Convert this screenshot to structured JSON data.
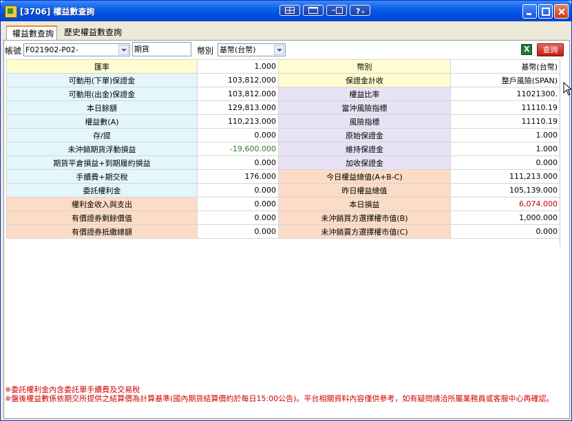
{
  "window": {
    "title": "[3706] 權益數查詢"
  },
  "tabs": [
    {
      "label": "權益數查詢"
    },
    {
      "label": "歷史權益數查詢"
    }
  ],
  "filters": {
    "account_label": "帳號",
    "account_value": "F021902-P02-",
    "type_value": "期貨",
    "currency_label": "幣別",
    "currency_value": "基幣(台幣)",
    "query_label": "查詢"
  },
  "table": {
    "rows": [
      {
        "l": "匯率",
        "lv": "1.000",
        "r": "幣別",
        "rv": "基幣(台幣)",
        "lc": "y",
        "rc": "y",
        "lvc": "",
        "rvc": ""
      },
      {
        "l": "可動用(下單)保證金",
        "lv": "103,812.000",
        "r": "保證金計收",
        "rv": "整戶風險(SPAN)",
        "lc": "b",
        "rc": "y",
        "lvc": "",
        "rvc": ""
      },
      {
        "l": "可動用(出金)保證金",
        "lv": "103,812.000",
        "r": "權益比率",
        "rv": "11021300.",
        "lc": "b",
        "rc": "p",
        "lvc": "",
        "rvc": ""
      },
      {
        "l": "本日餘額",
        "lv": "129,813.000",
        "r": "當沖風險指標",
        "rv": "11110.19",
        "lc": "b",
        "rc": "p",
        "lvc": "",
        "rvc": ""
      },
      {
        "l": "權益數(A)",
        "lv": "110,213.000",
        "r": "風險指標",
        "rv": "11110.19",
        "lc": "b",
        "rc": "p",
        "lvc": "",
        "rvc": ""
      },
      {
        "l": "存/提",
        "lv": "0.000",
        "r": "原始保證金",
        "rv": "1.000",
        "lc": "b",
        "rc": "p",
        "lvc": "",
        "rvc": ""
      },
      {
        "l": "未沖銷期貨浮動損益",
        "lv": "-19,600.000",
        "r": "維持保證金",
        "rv": "1.000",
        "lc": "b",
        "rc": "p",
        "lvc": "green",
        "rvc": ""
      },
      {
        "l": "期貨平倉損益+到期履約損益",
        "lv": "0.000",
        "r": "加收保證金",
        "rv": "0.000",
        "lc": "b",
        "rc": "p",
        "lvc": "",
        "rvc": ""
      },
      {
        "l": "手續費+期交稅",
        "lv": "176.000",
        "r": "今日權益總值(A+B-C)",
        "rv": "111,213.000",
        "lc": "b",
        "rc": "o",
        "lvc": "",
        "rvc": ""
      },
      {
        "l": "委託權利金",
        "lv": "0.000",
        "r": "昨日權益總值",
        "rv": "105,139.000",
        "lc": "b",
        "rc": "o",
        "lvc": "",
        "rvc": ""
      },
      {
        "l": "權利金收入與支出",
        "lv": "0.000",
        "r": "本日損益",
        "rv": "6,074.000",
        "lc": "o",
        "rc": "o",
        "lvc": "",
        "rvc": "red"
      },
      {
        "l": "有價證券剩餘價值",
        "lv": "0.000",
        "r": "未沖銷買方選擇權市值(B)",
        "rv": "1,000.000",
        "lc": "o",
        "rc": "o",
        "lvc": "",
        "rvc": ""
      },
      {
        "l": "有價證券抵繳總額",
        "lv": "0.000",
        "r": "未沖銷賣方選擇權市值(C)",
        "rv": "0.000",
        "lc": "o",
        "rc": "o",
        "lvc": "",
        "rvc": ""
      }
    ]
  },
  "footer": {
    "note1": "※委託權利金內含委託單手續費及交易稅",
    "note2": "※盤後權益數係依期交所提供之結算價為計算基準(國內期貨結算價約於每日15:00公告)。平台相關資料內容僅供參考，如有疑問請洽所屬業務員或客服中心再確認。"
  }
}
